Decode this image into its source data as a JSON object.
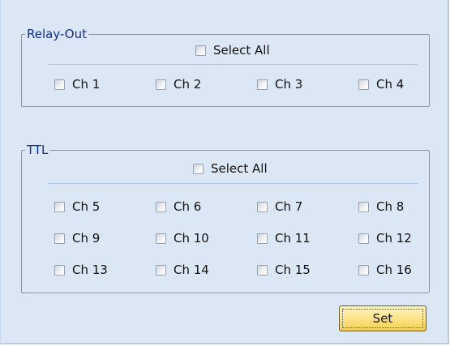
{
  "relay_out": {
    "title": "Relay-Out",
    "select_all": "Select All",
    "channels": [
      "Ch 1",
      "Ch 2",
      "Ch 3",
      "Ch 4"
    ]
  },
  "ttl": {
    "title": "TTL",
    "select_all": "Select All",
    "channels": [
      "Ch 5",
      "Ch 6",
      "Ch 7",
      "Ch 8",
      "Ch 9",
      "Ch 10",
      "Ch 11",
      "Ch 12",
      "Ch 13",
      "Ch 14",
      "Ch 15",
      "Ch 16"
    ]
  },
  "set_button": "Set"
}
